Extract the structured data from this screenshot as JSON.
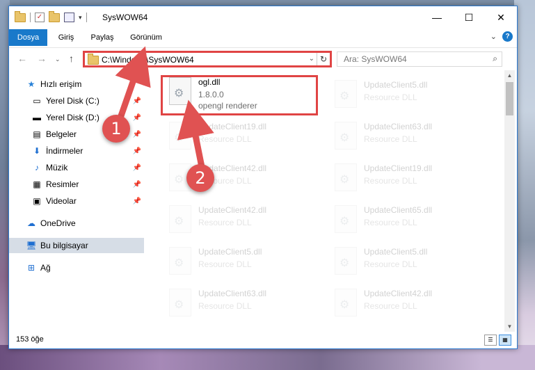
{
  "window": {
    "title": "SysWOW64",
    "controls": {
      "minimize": "—",
      "maximize": "☐",
      "close": "✕"
    }
  },
  "ribbon": {
    "tabs": [
      {
        "label": "Dosya"
      },
      {
        "label": "Giriş"
      },
      {
        "label": "Paylaş"
      },
      {
        "label": "Görünüm"
      }
    ],
    "help": "?"
  },
  "nav": {
    "address": "C:\\Windows\\SysWOW64",
    "search_placeholder": "Ara: SysWOW64"
  },
  "sidebar": {
    "items": [
      {
        "label": "Hızlı erişim",
        "icon": "star-icon",
        "pinned": false
      },
      {
        "label": "Yerel Disk (C:)",
        "icon": "drive-icon",
        "pinned": true
      },
      {
        "label": "Yerel Disk (D:)",
        "icon": "drive-icon",
        "pinned": true
      },
      {
        "label": "Belgeler",
        "icon": "documents-icon",
        "pinned": true
      },
      {
        "label": "İndirmeler",
        "icon": "download-icon",
        "pinned": true
      },
      {
        "label": "Müzik",
        "icon": "music-icon",
        "pinned": true
      },
      {
        "label": "Resimler",
        "icon": "pictures-icon",
        "pinned": true
      },
      {
        "label": "Videolar",
        "icon": "video-icon",
        "pinned": true
      },
      {
        "label": "OneDrive",
        "icon": "cloud-icon",
        "pinned": false
      },
      {
        "label": "Bu bilgisayar",
        "icon": "computer-icon",
        "pinned": false,
        "selected": true
      },
      {
        "label": "Ağ",
        "icon": "network-icon",
        "pinned": false
      }
    ]
  },
  "files": {
    "highlighted": {
      "name": "ogl.dll",
      "version": "1.8.0.0",
      "description": "opengl renderer"
    },
    "left_column": [
      {
        "name": "UpdateClient19.dll",
        "type": "Resource DLL"
      },
      {
        "name": "UpdateClient42.dll",
        "type": "Resource DLL"
      },
      {
        "name": "UpdateClient42.dll",
        "type": "Resource DLL"
      },
      {
        "name": "UpdateClient5.dll",
        "type": "Resource DLL"
      },
      {
        "name": "UpdateClient63.dll",
        "type": "Resource DLL"
      }
    ],
    "right_column": [
      {
        "name": "UpdateClient5.dll",
        "type": "Resource DLL"
      },
      {
        "name": "UpdateClient63.dll",
        "type": "Resource DLL"
      },
      {
        "name": "UpdateClient19.dll",
        "type": "Resource DLL"
      },
      {
        "name": "UpdateClient65.dll",
        "type": "Resource DLL"
      },
      {
        "name": "UpdateClient5.dll",
        "type": "Resource DLL"
      },
      {
        "name": "UpdateClient42.dll",
        "type": "Resource DLL"
      }
    ]
  },
  "status": {
    "count": "153 öğe"
  },
  "annotations": {
    "step1": "1",
    "step2": "2",
    "accent": "#e05252"
  }
}
